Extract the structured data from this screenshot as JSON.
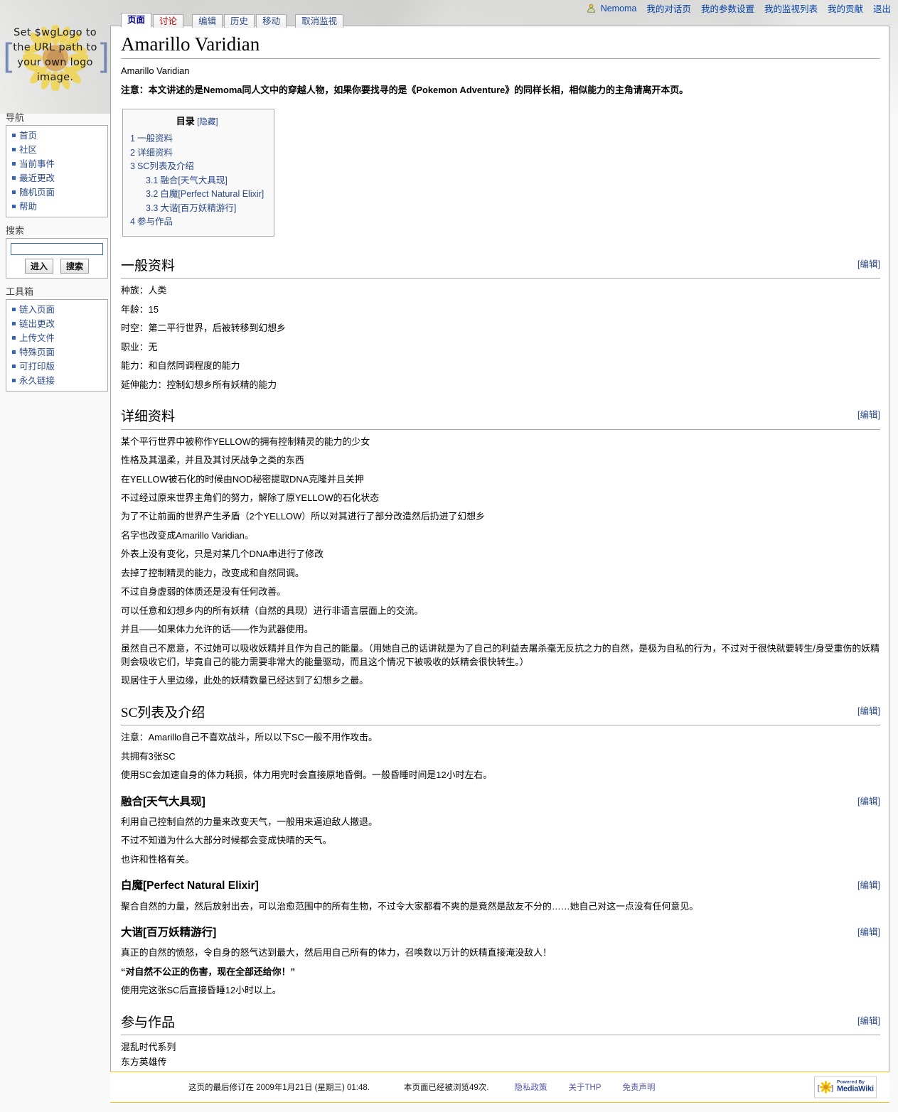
{
  "personal": {
    "username": "Nemoma",
    "items": [
      {
        "label": "我的对话页"
      },
      {
        "label": "我的参数设置"
      },
      {
        "label": "我的监视列表"
      },
      {
        "label": "我的贡献"
      },
      {
        "label": "退出"
      }
    ]
  },
  "logo": {
    "text": "Set $wgLogo to the URL path to your own logo image."
  },
  "tabs": [
    {
      "label": "页面",
      "state": "selected"
    },
    {
      "label": "讨论",
      "state": "new"
    },
    {
      "label": "编辑",
      "state": "normal"
    },
    {
      "label": "历史",
      "state": "normal"
    },
    {
      "label": "移动",
      "state": "normal"
    },
    {
      "label": "取消监视",
      "state": "normal"
    }
  ],
  "sidebar": {
    "navigation": {
      "heading": "导航",
      "items": [
        {
          "label": "首页"
        },
        {
          "label": "社区"
        },
        {
          "label": "当前事件"
        },
        {
          "label": "最近更改"
        },
        {
          "label": "随机页面"
        },
        {
          "label": "帮助"
        }
      ]
    },
    "search": {
      "heading": "搜索",
      "value": "",
      "placeholder": "",
      "go_label": "进入",
      "search_label": "搜索"
    },
    "toolbox": {
      "heading": "工具箱",
      "items": [
        {
          "label": "链入页面"
        },
        {
          "label": "链出更改"
        },
        {
          "label": "上传文件"
        },
        {
          "label": "特殊页面"
        },
        {
          "label": "可打印版"
        },
        {
          "label": "永久链接"
        }
      ]
    }
  },
  "article": {
    "title": "Amarillo Varidian",
    "subtitle": "Amarillo Varidian",
    "notice": "注意：本文讲述的是Nemoma同人文中的穿越人物，如果你要找寻的是《Pokemon Adventure》的同样长相，相似能力的主角请离开本页。",
    "edit_label": "[编辑]"
  },
  "toc": {
    "title": "目录",
    "toggle": "[隐藏]",
    "items": [
      {
        "num": "1",
        "label": "一般资料",
        "level": 1
      },
      {
        "num": "2",
        "label": "详细资料",
        "level": 1
      },
      {
        "num": "3",
        "label": "SC列表及介绍",
        "level": 1
      },
      {
        "num": "3.1",
        "label": "融合[天气大具现]",
        "level": 2
      },
      {
        "num": "3.2",
        "label": "白魔[Perfect Natural Elixir]",
        "level": 2
      },
      {
        "num": "3.3",
        "label": "大谐[百万妖精游行]",
        "level": 2
      },
      {
        "num": "4",
        "label": "参与作品",
        "level": 1
      }
    ]
  },
  "sections": {
    "general": {
      "heading": "一般资料",
      "lines": [
        "种族：人类",
        "年龄：15",
        "时空：第二平行世界，后被转移到幻想乡",
        "职业：无",
        "能力：和自然同调程度的能力",
        "延伸能力：控制幻想乡所有妖精的能力"
      ]
    },
    "details": {
      "heading": "详细资料",
      "lines": [
        "某个平行世界中被称作YELLOW的拥有控制精灵的能力的少女",
        "性格及其温柔，并且及其讨厌战争之类的东西",
        "在YELLOW被石化的时候由NOD秘密提取DNA克隆并且关押",
        "不过经过原来世界主角们的努力，解除了原YELLOW的石化状态",
        "为了不让前面的世界产生矛盾（2个YELLOW）所以对其进行了部分改造然后扔进了幻想乡",
        "名字也改变成Amarillo Varidian。",
        "外表上没有变化，只是对某几个DNA串进行了修改",
        "去掉了控制精灵的能力，改变成和自然同调。",
        "不过自身虚弱的体质还是没有任何改善。",
        "可以任意和幻想乡内的所有妖精（自然的具现）进行非语言层面上的交流。",
        "并且——如果体力允许的话——作为武器使用。",
        "虽然自己不愿意，不过她可以吸收妖精并且作为自己的能量。（用她自己的话讲就是为了自己的利益去屠杀毫无反抗之力的自然，是极为自私的行为，不过对于很快就要转生/身受重伤的妖精则会吸收它们，毕竟自己的能力需要非常大的能量驱动，而且这个情况下被吸收的妖精会很快转生。）",
        "现居住于人里边缘，此处的妖精数量已经达到了幻想乡之最。"
      ]
    },
    "sc": {
      "heading": "SC列表及介绍",
      "lines": [
        "注意：Amarillo自己不喜欢战斗，所以以下SC一般不用作攻击。",
        "共拥有3张SC",
        "使用SC会加速自身的体力耗损，体力用完时会直接原地昏倒。一般昏睡时间是12小时左右。"
      ],
      "subsections": [
        {
          "heading": "融合[天气大具现]",
          "lines": [
            "利用自己控制自然的力量来改变天气，一般用来逼迫敌人撤退。",
            "不过不知道为什么大部分时候都会变成快晴的天气。",
            "也许和性格有关。"
          ]
        },
        {
          "heading": "白魔[Perfect Natural Elixir]",
          "lines": [
            "聚合自然的力量，然后放射出去，可以治愈范围中的所有生物，不过令大家都看不爽的是竟然是敌友不分的……她自己对这一点没有任何意见。"
          ]
        },
        {
          "heading": "大谐[百万妖精游行]",
          "lines": [
            "真正的自然的愤怒，令自身的怒气达到最大，然后用自己所有的体力，召唤数以万计的妖精直接淹没敌人！",
            "“对自然不公正的伤害，现在全部还给你！”",
            "使用完这张SC后直接昏睡12小时以上。"
          ]
        }
      ]
    },
    "works": {
      "heading": "参与作品",
      "lines": [
        "混乱时代系列",
        "东方英雄传"
      ]
    }
  },
  "footer": {
    "lastmod": "这页的最后修订在 2009年1月21日 (星期三) 01:48.",
    "viewcount": "本页面已经被浏览49次.",
    "links": [
      {
        "label": "隐私政策"
      },
      {
        "label": "关于THP"
      },
      {
        "label": "免责声明"
      }
    ],
    "poweredby_top": "Powered By",
    "poweredby_bottom": "MediaWiki"
  }
}
